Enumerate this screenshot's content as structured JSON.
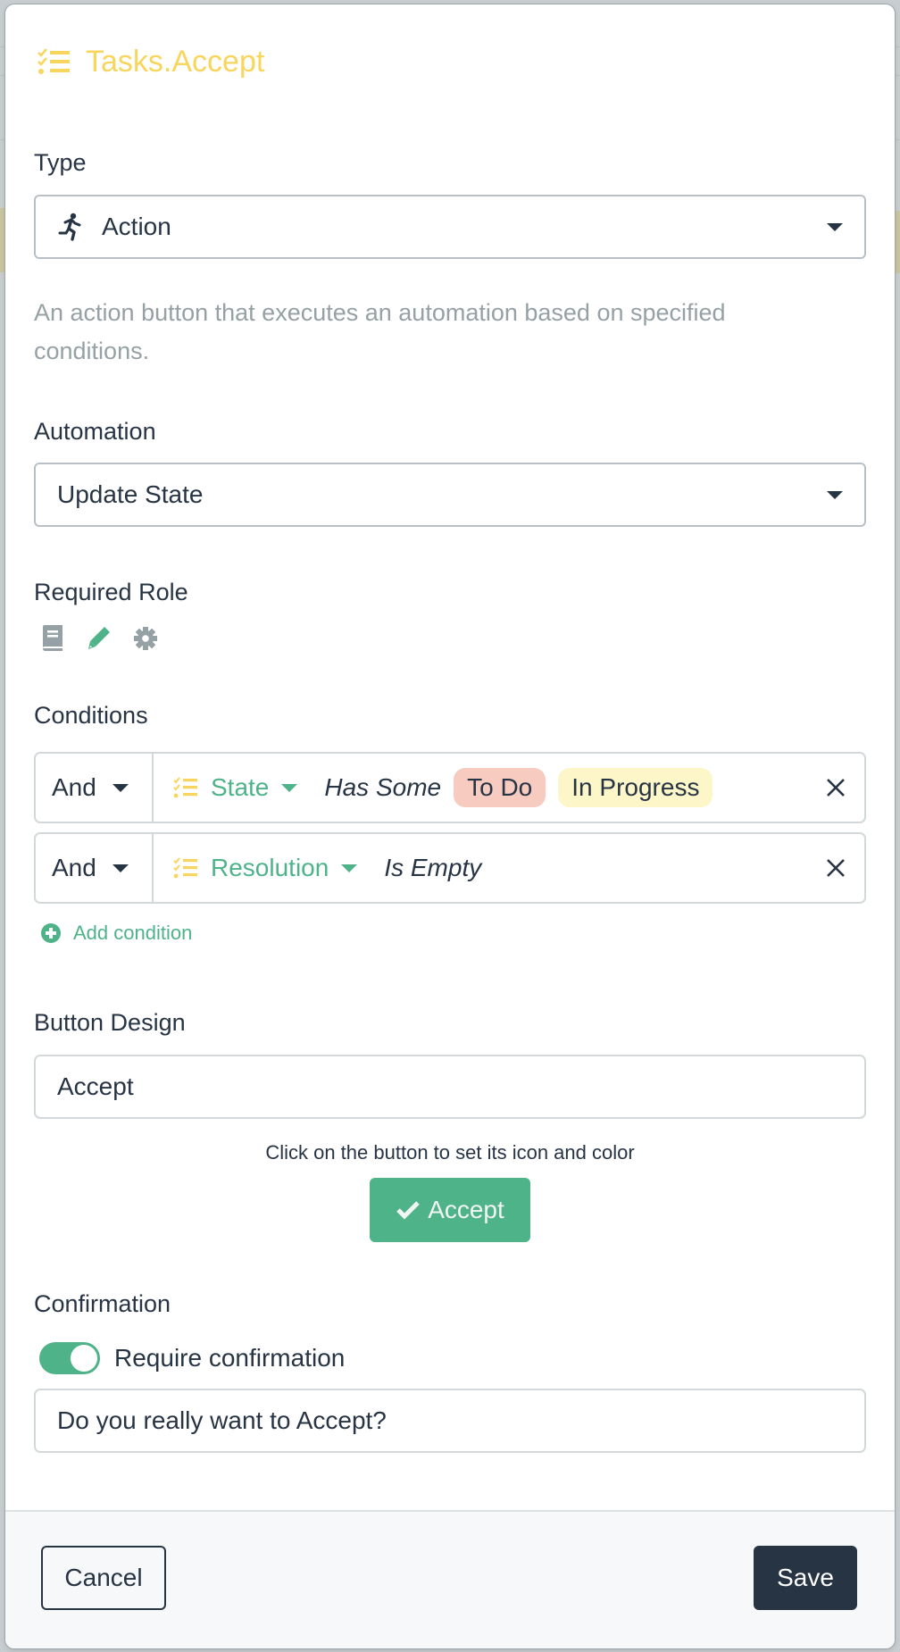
{
  "modal": {
    "title": "Tasks.Accept",
    "title_icon": "tasks-list-icon",
    "title_color": "#f8d55c"
  },
  "type": {
    "label": "Type",
    "icon": "running-person-icon",
    "value": "Action",
    "description": "An action button that executes an automation based on specified conditions."
  },
  "automation": {
    "label": "Automation",
    "value": "Update State"
  },
  "required_role": {
    "label": "Required Role",
    "roles": [
      {
        "name": "reader",
        "icon": "book-icon",
        "active": false,
        "color": "#95a1a5"
      },
      {
        "name": "editor",
        "icon": "pencil-icon",
        "active": true,
        "color": "#4fb38a"
      },
      {
        "name": "admin",
        "icon": "gear-icon",
        "active": false,
        "color": "#95a1a5"
      }
    ]
  },
  "conditions": {
    "label": "Conditions",
    "rows": [
      {
        "conjunction": "And",
        "field_icon": "tasks-list-icon",
        "field": "State",
        "operator": "Has Some",
        "values": [
          {
            "label": "To Do",
            "color": "#f7cbbf"
          },
          {
            "label": "In Progress",
            "color": "#fdf6c9"
          }
        ]
      },
      {
        "conjunction": "And",
        "field_icon": "tasks-list-icon",
        "field": "Resolution",
        "operator": "Is Empty",
        "values": []
      }
    ],
    "add_label": "Add condition"
  },
  "button_design": {
    "label": "Button Design",
    "value": "Accept",
    "hint": "Click on the button to set its icon and color",
    "preview_label": "Accept",
    "preview_icon": "check-icon",
    "preview_color": "#4fb38a"
  },
  "confirmation": {
    "label": "Confirmation",
    "toggle_label": "Require confirmation",
    "toggle_on": true,
    "message": "Do you really want to Accept?"
  },
  "footer": {
    "cancel_label": "Cancel",
    "save_label": "Save"
  },
  "colors": {
    "accent_green": "#4fb38a",
    "dark": "#273444",
    "muted": "#95a1a5"
  }
}
